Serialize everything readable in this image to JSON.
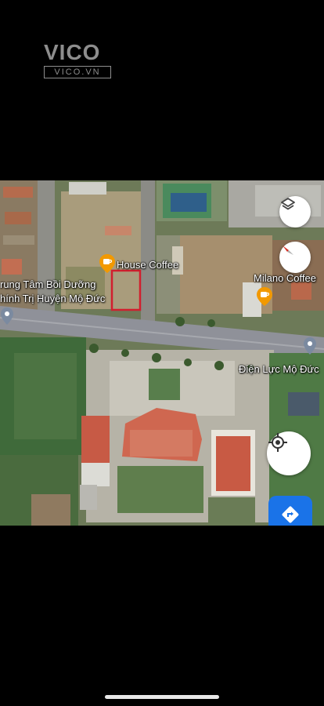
{
  "watermark": {
    "logo": "VICO",
    "site": "VICO.VN"
  },
  "map": {
    "places": [
      {
        "name": "House Coffee",
        "type": "cafe"
      },
      {
        "name": "Milano Coffee",
        "type": "cafe"
      },
      {
        "name_line1": "rung Tâm Bồi Dưỡng",
        "name_line2": "hính Trị Huyện Mộ Đức",
        "type": "place"
      },
      {
        "name": "Điện Lực Mộ Đức",
        "type": "place"
      }
    ],
    "highlight_color": "#d11f2e"
  },
  "controls": {
    "layers": "layers-icon",
    "compass": "compass-icon",
    "my_location": "my-location-icon",
    "directions": "directions-icon"
  },
  "colors": {
    "accent": "#1a73e8",
    "cafe_pin": "#f29900"
  }
}
